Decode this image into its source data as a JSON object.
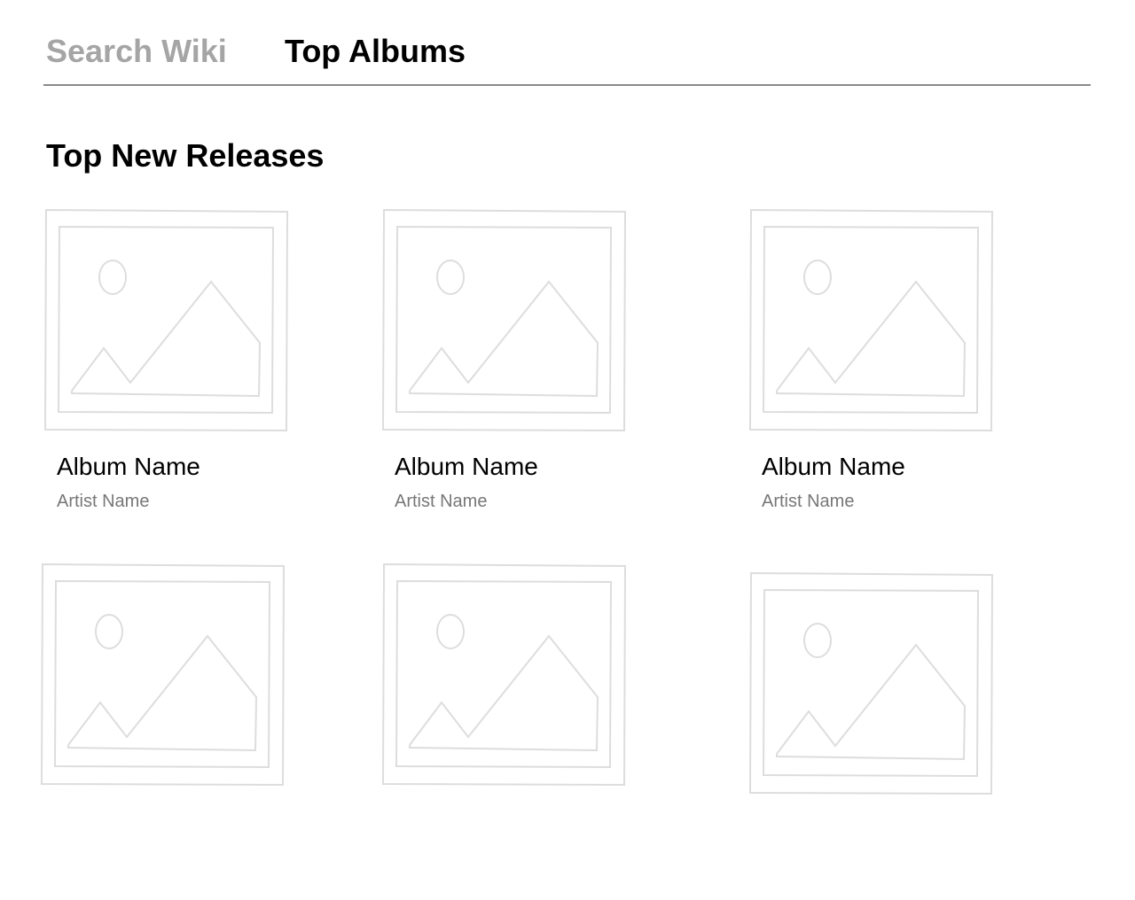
{
  "tabs": [
    {
      "label": "Search Wiki",
      "active": false
    },
    {
      "label": "Top Albums",
      "active": true
    }
  ],
  "section": {
    "title": "Top New Releases"
  },
  "albums": [
    {
      "name": "Album Name",
      "artist": "Artist Name"
    },
    {
      "name": "Album Name",
      "artist": "Artist Name"
    },
    {
      "name": "Album Name",
      "artist": "Artist Name"
    },
    {
      "name": "",
      "artist": ""
    },
    {
      "name": "",
      "artist": ""
    },
    {
      "name": "",
      "artist": ""
    }
  ],
  "colors": {
    "active_tab": "#000000",
    "inactive_tab": "#a5a5a5",
    "divider": "#8a8a8a",
    "placeholder_stroke": "#dddddd",
    "artist_text": "#777777"
  },
  "icons": {
    "album_art": "image-placeholder-icon"
  }
}
